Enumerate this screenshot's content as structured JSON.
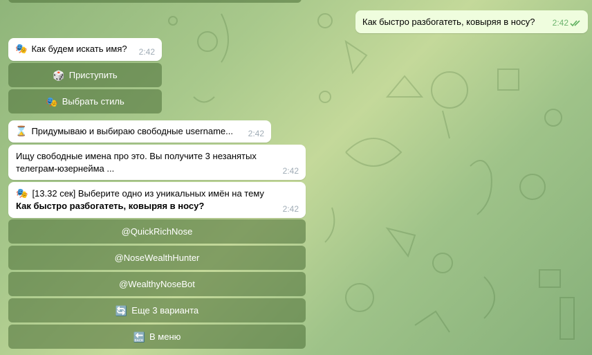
{
  "outgoing": {
    "text": "Как быстро разбогатеть, ковыряя в носу?",
    "time": "2:42",
    "status_icon": "double-check-icon"
  },
  "msg_search": {
    "icon": "🎭",
    "text": "Как будем искать имя?",
    "time": "2:42"
  },
  "btn_start": {
    "icon": "🎲",
    "label": "Приступить"
  },
  "btn_style": {
    "icon": "🎭",
    "label": "Выбрать стиль"
  },
  "msg_thinking": {
    "icon": "⌛",
    "text": "Придумываю и выбираю свободные username...",
    "time": "2:42"
  },
  "msg_searching": {
    "text": "Ищу свободные имена про это. Вы получите 3 незанятых телеграм-юзернейма ...",
    "time": "2:42"
  },
  "msg_choose": {
    "icon": "🎭",
    "text_plain": "[13.32 сек] Выберите одно из уникальных имён на тему",
    "text_bold": "Как быстро разбогатеть, ковыряя в носу?",
    "time": "2:42"
  },
  "options": [
    {
      "label": "@QuickRichNose"
    },
    {
      "label": "@NoseWealthHunter"
    },
    {
      "label": "@WealthyNoseBot"
    }
  ],
  "btn_more": {
    "icon": "🔄",
    "label": "Еще 3 варианта"
  },
  "btn_menu": {
    "icon": "🔙",
    "label": "В меню"
  }
}
